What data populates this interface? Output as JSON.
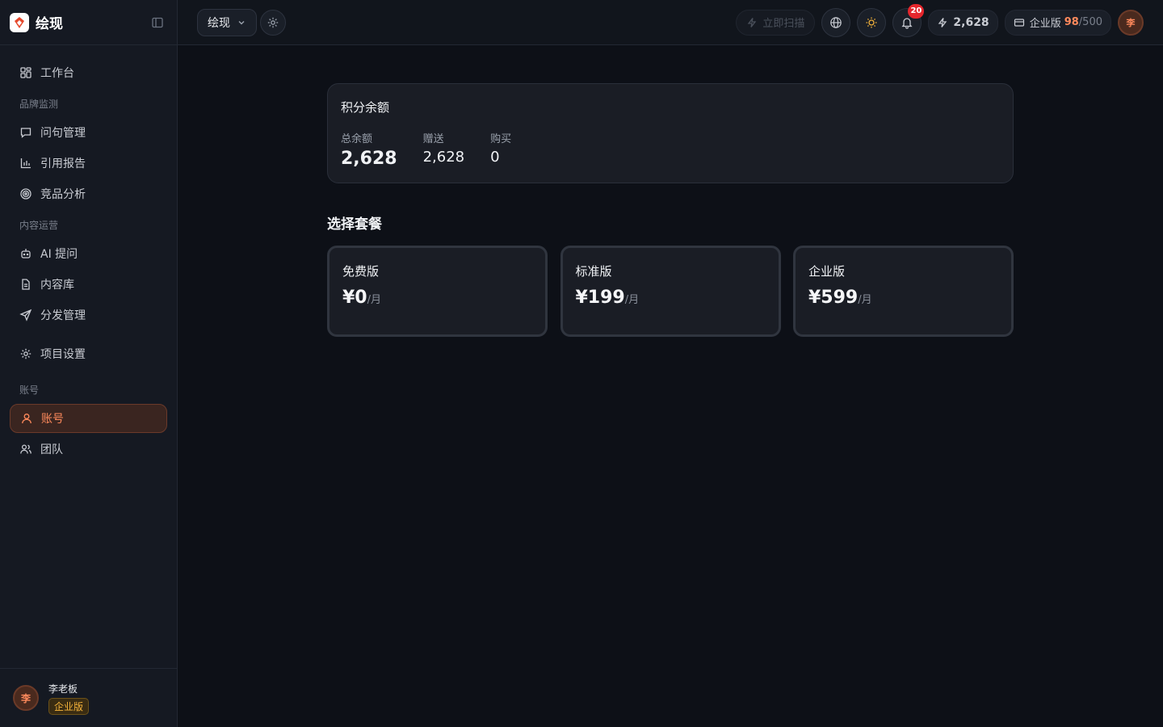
{
  "brand": {
    "name": "绘现"
  },
  "sidebar": {
    "workbench": "工作台",
    "sections": {
      "brand_monitor": "品牌监测",
      "content_ops": "内容运营",
      "account": "账号"
    },
    "items": {
      "questions": "问句管理",
      "citation_report": "引用报告",
      "competitor": "竞品分析",
      "ai_prompt": "AI 提问",
      "content_lib": "内容库",
      "distribution": "分发管理",
      "project_settings": "项目设置",
      "account": "账号",
      "team": "团队"
    },
    "user": {
      "name": "李老板",
      "avatar": "李",
      "plan": "企业版"
    }
  },
  "topbar": {
    "project": "绘现",
    "scan": "立即扫描",
    "notification_count": "20",
    "credits": "2,628",
    "plan": {
      "label": "企业版",
      "used": "98",
      "total": "/500"
    },
    "avatar": "李"
  },
  "balance": {
    "title": "积分余额",
    "total_label": "总余额",
    "total_value": "2,628",
    "gift_label": "赠送",
    "gift_value": "2,628",
    "purchase_label": "购买",
    "purchase_value": "0"
  },
  "plans": {
    "title": "选择套餐",
    "items": [
      {
        "name": "免费版",
        "price": "¥0",
        "unit": "/月"
      },
      {
        "name": "标准版",
        "price": "¥199",
        "unit": "/月"
      },
      {
        "name": "企业版",
        "price": "¥599",
        "unit": "/月"
      }
    ]
  },
  "colors": {
    "accent": "#ff8a5c",
    "background": "#0d1017",
    "sidebar": "#151922",
    "badge_red": "#e5262c",
    "plan_gold": "#f5b33b"
  }
}
